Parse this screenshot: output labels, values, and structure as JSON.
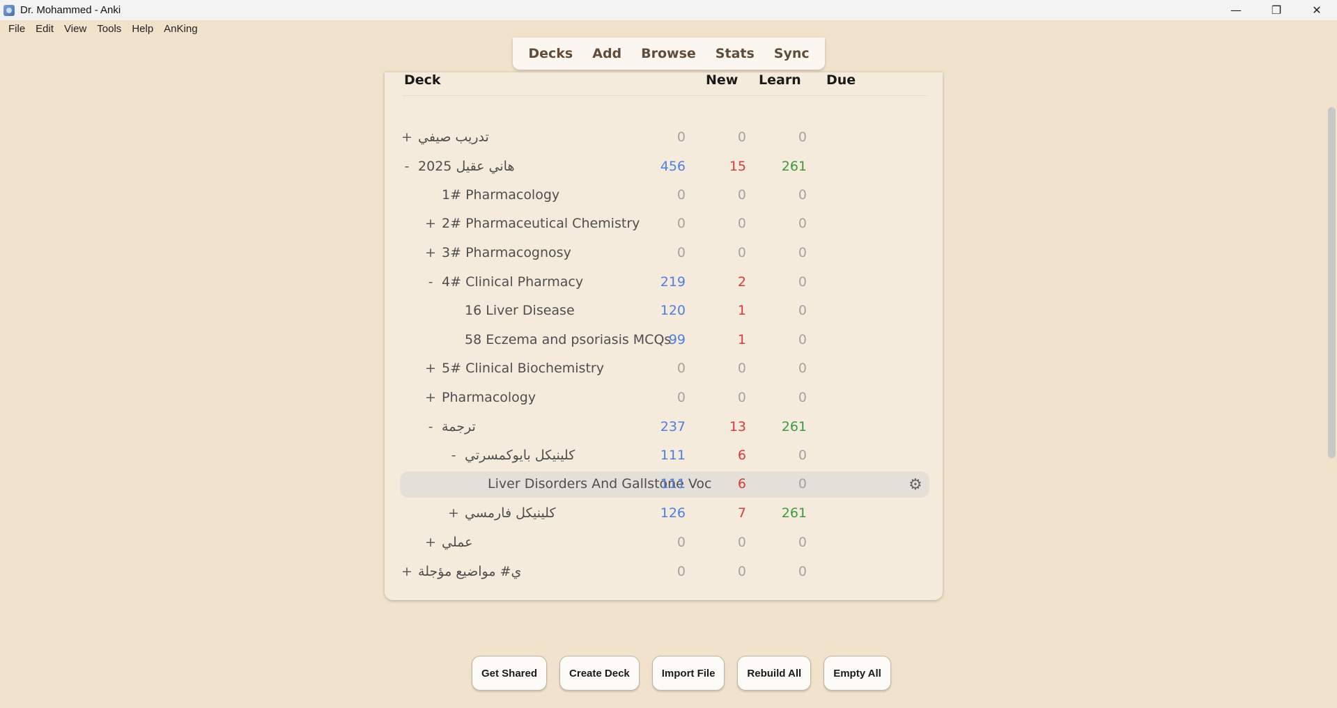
{
  "window": {
    "title": "Dr. Mohammed - Anki",
    "controls": {
      "minimize": "—",
      "maximize": "❐",
      "close": "✕"
    }
  },
  "menu": [
    "File",
    "Edit",
    "View",
    "Tools",
    "Help",
    "AnKing"
  ],
  "toolbar": [
    "Decks",
    "Add",
    "Browse",
    "Stats",
    "Sync"
  ],
  "table": {
    "headers": {
      "deck": "Deck",
      "new": "New",
      "learn": "Learn",
      "due": "Due"
    },
    "rows": [
      {
        "name": "تدريب صيفي",
        "expander": "+",
        "new": "0",
        "learn": "0",
        "due": "0"
      },
      {
        "name": "هاني عقيل 2025",
        "expander": "-",
        "new": "456",
        "learn": "15",
        "due": "261"
      },
      {
        "name": "1# Pharmacology",
        "expander": "",
        "new": "0",
        "learn": "0",
        "due": "0"
      },
      {
        "name": "2# Pharmaceutical Chemistry",
        "expander": "+",
        "new": "0",
        "learn": "0",
        "due": "0"
      },
      {
        "name": "3# Pharmacognosy",
        "expander": "+",
        "new": "0",
        "learn": "0",
        "due": "0"
      },
      {
        "name": "4# Clinical Pharmacy",
        "expander": "-",
        "new": "219",
        "learn": "2",
        "due": "0"
      },
      {
        "name": "16 Liver Disease",
        "expander": "",
        "new": "120",
        "learn": "1",
        "due": "0"
      },
      {
        "name": "58 Eczema and psoriasis MCQs",
        "expander": "",
        "new": "99",
        "learn": "1",
        "due": "0"
      },
      {
        "name": "5# Clinical Biochemistry",
        "expander": "+",
        "new": "0",
        "learn": "0",
        "due": "0"
      },
      {
        "name": "Pharmacology",
        "expander": "+",
        "new": "0",
        "learn": "0",
        "due": "0"
      },
      {
        "name": "ترجمة",
        "expander": "-",
        "new": "237",
        "learn": "13",
        "due": "261"
      },
      {
        "name": "كلينيكل بايوكمسرتي",
        "expander": "-",
        "new": "111",
        "learn": "6",
        "due": "0"
      },
      {
        "name": "Liver Disorders And Gallstone Voc",
        "expander": "",
        "new": "111",
        "learn": "6",
        "due": "0"
      },
      {
        "name": "كلينيكل فارمسي",
        "expander": "+",
        "new": "126",
        "learn": "7",
        "due": "261"
      },
      {
        "name": "عملي",
        "expander": "+",
        "new": "0",
        "learn": "0",
        "due": "0"
      },
      {
        "name": "ي# مواضيع مؤجلة",
        "expander": "+",
        "new": "0",
        "learn": "0",
        "due": "0"
      }
    ]
  },
  "options_icon": "gear-icon",
  "buttons": [
    "Get Shared",
    "Create Deck",
    "Import File",
    "Rebuild All",
    "Empty All"
  ],
  "colors": {
    "background": "#f0e2cb",
    "new": "#4f7ee0",
    "learn": "#d93a3a",
    "due": "#3d9a3d",
    "zero": "#a3a3a3"
  }
}
